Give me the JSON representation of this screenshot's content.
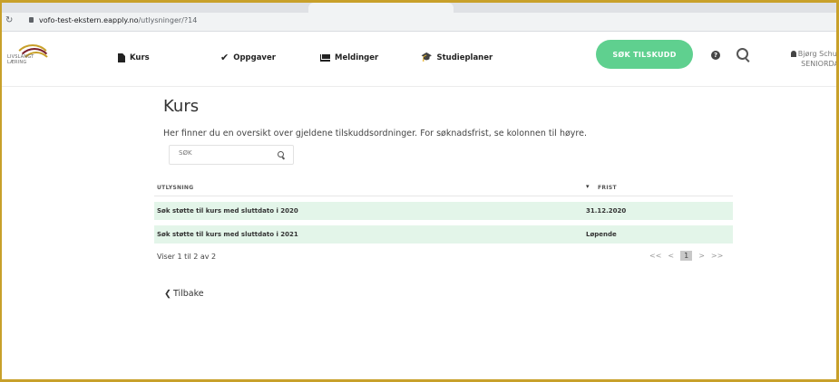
{
  "browser": {
    "url_host": "vofo-test-ekstern.eapply.no",
    "url_path": "/utlysninger/?14"
  },
  "logo": {
    "line1": "LIVSLANGT",
    "line2": "LÆRING"
  },
  "nav": {
    "items": [
      {
        "label": "Kurs",
        "icon": "file-icon"
      },
      {
        "label": "Oppgaver",
        "icon": "check-icon"
      },
      {
        "label": "Meldinger",
        "icon": "mail-icon"
      },
      {
        "label": "Studieplaner",
        "icon": "graduation-cap-icon"
      }
    ],
    "apply_button": "SØK TILSKUDD",
    "user_name": "Bjørg Schul",
    "user_role": "SENIORDA"
  },
  "colors": {
    "accent_green": "#5fd08f",
    "row_bg": "#e3f5e9",
    "frame": "#c8a02a"
  },
  "page": {
    "title": "Kurs",
    "subtitle": "Her finner du en oversikt over gjeldene tilskuddsordninger. For søknadsfrist, se kolonnen til høyre.",
    "search_placeholder": "SØK"
  },
  "table": {
    "columns": [
      "UTLYSNING",
      "FRIST"
    ],
    "rows": [
      {
        "title": "Søk støtte til kurs med sluttdato i 2020",
        "deadline": "31.12.2020"
      },
      {
        "title": "Søk støtte til kurs med sluttdato i 2021",
        "deadline": "Løpende"
      }
    ],
    "info": "Viser 1 til 2 av 2"
  },
  "pager": {
    "first": "<<",
    "prev": "<",
    "current": "1",
    "next": ">",
    "last": ">>"
  },
  "back_label": "Tilbake"
}
